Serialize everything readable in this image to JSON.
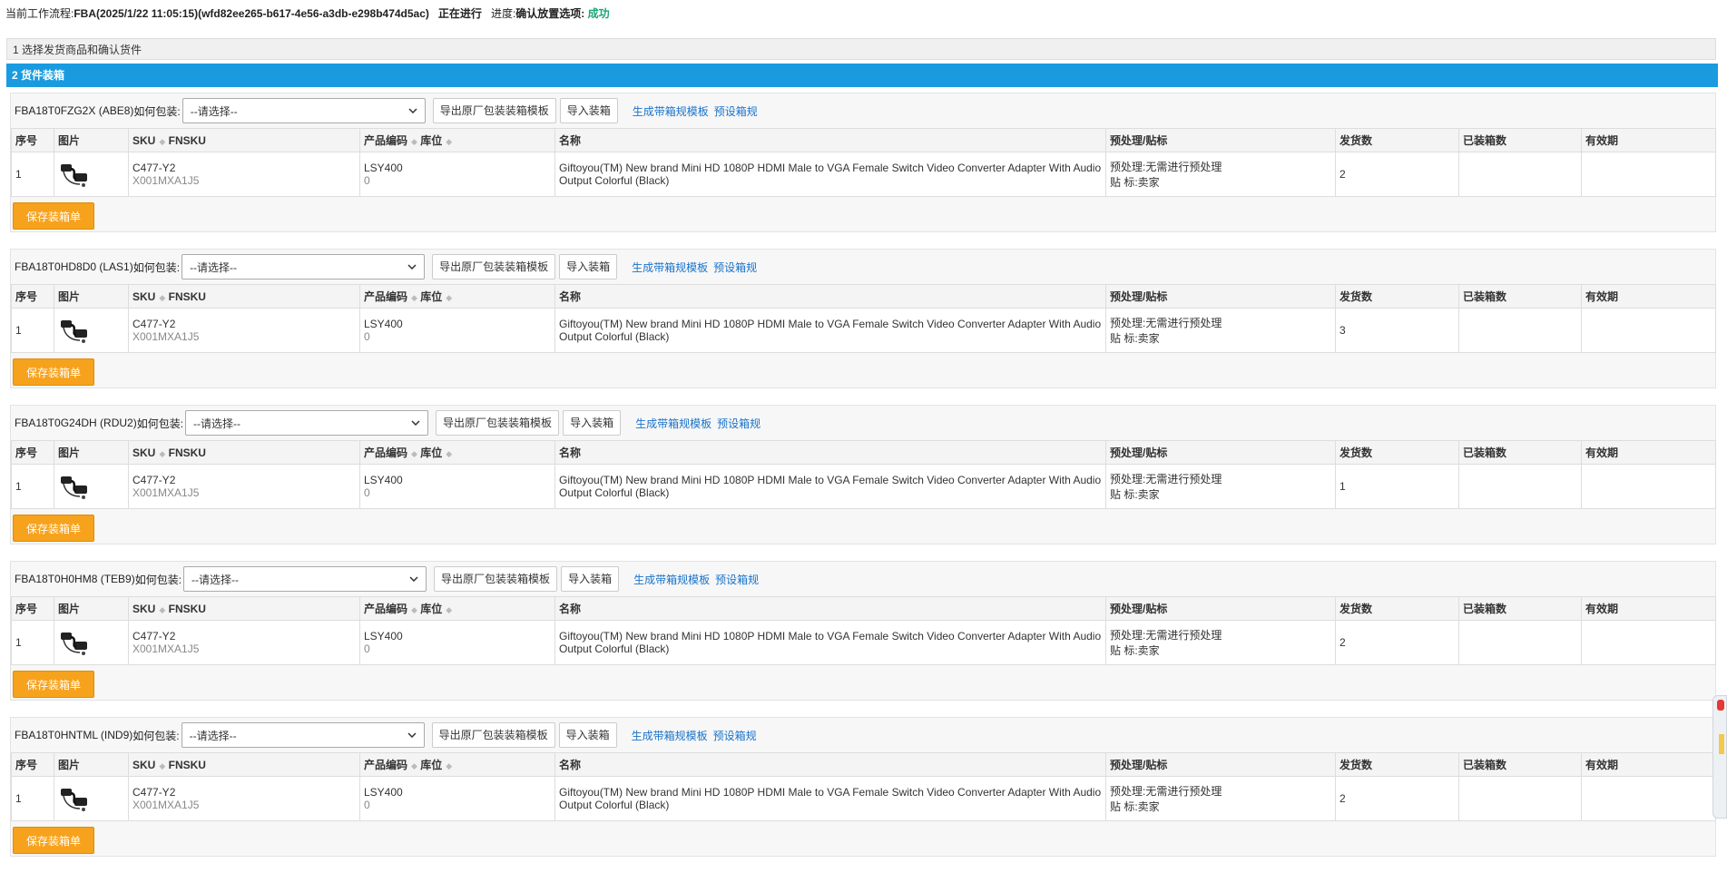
{
  "header": {
    "workflow_label": "当前工作流程:",
    "workflow_value": "FBA(2025/1/22 11:05:15)(wfd82ee265-b617-4e56-a3db-e298b474d5ac)",
    "state": "正在进行",
    "progress_label": "进度:",
    "progress_step": "确认放置选项:",
    "progress_status": "成功"
  },
  "steps": {
    "step1": "1 选择发货商品和确认货件",
    "step2": "2 货件装箱"
  },
  "common": {
    "pack_label": "如何包装:",
    "select_placeholder": "--请选择--",
    "btn_export": "导出原厂包装装箱模板",
    "btn_import": "导入装箱",
    "link_generate": "生成带箱规模板",
    "link_preset": "预设箱规",
    "save_label": "保存装箱单"
  },
  "columns": {
    "index": "序号",
    "image": "图片",
    "sku": "SKU",
    "fnsku": "FNSKU",
    "product_code": "产品编码",
    "location": "库位",
    "name": "名称",
    "prep": "预处理/贴标",
    "ship_qty": "发货数",
    "boxed_qty": "已装箱数",
    "expiry": "有效期"
  },
  "shipments": [
    {
      "id": "FBA18T0FZG2X (ABE8)",
      "row": {
        "index": "1",
        "sku": "C477-Y2",
        "fnsku": "X001MXA1J5",
        "product_code": "LSY400",
        "location": "0",
        "name": "Giftoyou(TM) New brand Mini HD 1080P HDMI Male to VGA Female Switch Video Converter Adapter With Audio Output Colorful (Black)",
        "prep": "预处理:无需进行预处理",
        "label": "贴 标:卖家",
        "ship_qty": "2",
        "boxed_qty": "",
        "expiry": ""
      }
    },
    {
      "id": "FBA18T0HD8D0 (LAS1)",
      "row": {
        "index": "1",
        "sku": "C477-Y2",
        "fnsku": "X001MXA1J5",
        "product_code": "LSY400",
        "location": "0",
        "name": "Giftoyou(TM) New brand Mini HD 1080P HDMI Male to VGA Female Switch Video Converter Adapter With Audio Output Colorful (Black)",
        "prep": "预处理:无需进行预处理",
        "label": "贴 标:卖家",
        "ship_qty": "3",
        "boxed_qty": "",
        "expiry": ""
      }
    },
    {
      "id": "FBA18T0G24DH (RDU2)",
      "row": {
        "index": "1",
        "sku": "C477-Y2",
        "fnsku": "X001MXA1J5",
        "product_code": "LSY400",
        "location": "0",
        "name": "Giftoyou(TM) New brand Mini HD 1080P HDMI Male to VGA Female Switch Video Converter Adapter With Audio Output Colorful (Black)",
        "prep": "预处理:无需进行预处理",
        "label": "贴 标:卖家",
        "ship_qty": "1",
        "boxed_qty": "",
        "expiry": ""
      }
    },
    {
      "id": "FBA18T0H0HM8 (TEB9)",
      "row": {
        "index": "1",
        "sku": "C477-Y2",
        "fnsku": "X001MXA1J5",
        "product_code": "LSY400",
        "location": "0",
        "name": "Giftoyou(TM) New brand Mini HD 1080P HDMI Male to VGA Female Switch Video Converter Adapter With Audio Output Colorful (Black)",
        "prep": "预处理:无需进行预处理",
        "label": "贴 标:卖家",
        "ship_qty": "2",
        "boxed_qty": "",
        "expiry": ""
      }
    },
    {
      "id": "FBA18T0HNTML (IND9)",
      "row": {
        "index": "1",
        "sku": "C477-Y2",
        "fnsku": "X001MXA1J5",
        "product_code": "LSY400",
        "location": "0",
        "name": "Giftoyou(TM) New brand Mini HD 1080P HDMI Male to VGA Female Switch Video Converter Adapter With Audio Output Colorful (Black)",
        "prep": "预处理:无需进行预处理",
        "label": "贴 标:卖家",
        "ship_qty": "2",
        "boxed_qty": "",
        "expiry": ""
      }
    }
  ],
  "colors": {
    "step_active": "#1a9be0",
    "save_button": "#f7a21c",
    "link": "#1a73c9",
    "success": "#1aa67a"
  },
  "icons": {
    "product_thumbnail": "hdmi-vga-adapter-image",
    "select_arrow": "chevron-down-icon",
    "sort": "sort-icon"
  }
}
